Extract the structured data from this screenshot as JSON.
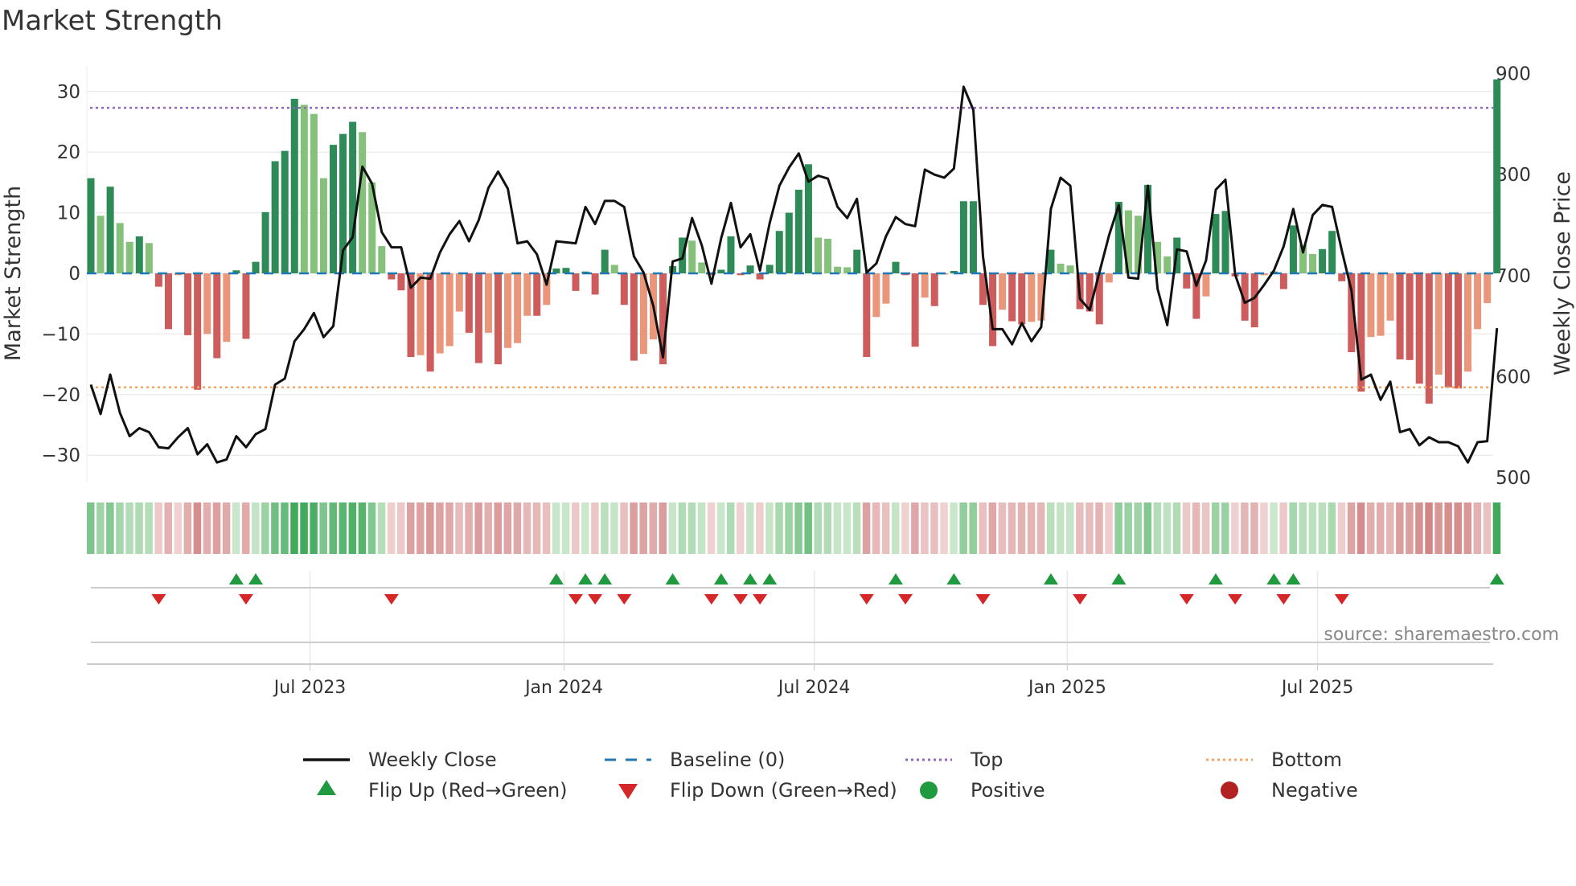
{
  "chart_data": {
    "type": "bar",
    "title": "Market Strength",
    "ylabel": "Market Strength",
    "y2label": "Weekly Close Price",
    "ylim": [
      -35,
      33.5
    ],
    "y2lim": [
      480,
      905
    ],
    "yticks": [
      30,
      20,
      10,
      0,
      -10,
      -20,
      -30
    ],
    "y2ticks": [
      900,
      800,
      700,
      600,
      500
    ],
    "xticks": [
      {
        "label": "Jul 2023",
        "week": 22.6
      },
      {
        "label": "Jan 2024",
        "week": 48.8
      },
      {
        "label": "Jul 2024",
        "week": 74.6
      },
      {
        "label": "Jan 2025",
        "week": 100.7
      },
      {
        "label": "Jul 2025",
        "week": 126.5
      }
    ],
    "top_level": 27.3,
    "bottom_level": -18.8,
    "strength": [
      15.7,
      9.5,
      14.3,
      8.3,
      5.2,
      6.1,
      5,
      -2.2,
      -9.2,
      -0.3,
      -10.2,
      -19.2,
      -10,
      -14,
      -11.3,
      0.5,
      -10.8,
      1.9,
      10.1,
      18.5,
      20.2,
      28.8,
      27.8,
      26.3,
      15.7,
      21.2,
      23,
      25,
      23.3,
      15,
      4.5,
      -1,
      -2.8,
      -13.8,
      -13.5,
      -16.2,
      -13.2,
      -12,
      -6.3,
      -9.8,
      -14.8,
      -9.8,
      -15,
      -12.3,
      -11.5,
      -7,
      -7,
      -5.2,
      0.8,
      0.9,
      -2.9,
      0.3,
      -3.5,
      3.9,
      1.4,
      -5.2,
      -14.4,
      -13.3,
      -10.9,
      -15,
      1.2,
      5.9,
      5.4,
      1.8,
      -0.3,
      0.6,
      6.1,
      -0.3,
      1.3,
      -1,
      1.4,
      7,
      10,
      13.8,
      18,
      5.9,
      5.7,
      1.1,
      1,
      3.9,
      -13.8,
      -7.2,
      -5,
      1.9,
      -0.3,
      -12.1,
      -4,
      -5.4,
      -0.2,
      0.4,
      11.9,
      11.9,
      -5.2,
      -12,
      -6,
      -7.9,
      -8.4,
      -8,
      -7.8,
      3.9,
      1.6,
      1.3,
      -5.9,
      -6.3,
      -8.4,
      -1.5,
      11.8,
      10.4,
      9.5,
      14.6,
      5.2,
      2.8,
      5.9,
      -2.5,
      -7.5,
      -3.8,
      9.8,
      10.3,
      -0.5,
      -7.8,
      -8.9,
      -0.3,
      0.3,
      -2.6,
      7.9,
      4.7,
      3.2,
      4,
      7,
      -1.3,
      -13,
      -19.5,
      -10.5,
      -10.3,
      -7.8,
      -14.2,
      -14.3,
      -18.2,
      -21.5,
      -16.7,
      -18.8,
      -19,
      -16.2,
      -9.2,
      -4.9,
      32
    ],
    "weekly_close": [
      592,
      563,
      602,
      564,
      541,
      549,
      545,
      530,
      529,
      540,
      549,
      523,
      533,
      515,
      518,
      541,
      530,
      543,
      548,
      592,
      598,
      635,
      647,
      663,
      639,
      650,
      725,
      738,
      808,
      791,
      743,
      728,
      728,
      688,
      698,
      697,
      723,
      741,
      754,
      734,
      755,
      787,
      803,
      786,
      732,
      734,
      721,
      691,
      734,
      733,
      732,
      768,
      751,
      774,
      774,
      768,
      719,
      703,
      670,
      619,
      714,
      717,
      757,
      730,
      692,
      737,
      772,
      728,
      741,
      705,
      752,
      789,
      807,
      821,
      793,
      799,
      796,
      768,
      757,
      776,
      703,
      712,
      739,
      758,
      751,
      749,
      805,
      800,
      797,
      806,
      887,
      864,
      719,
      647,
      647,
      632,
      653,
      635,
      649,
      766,
      797,
      789,
      677,
      666,
      703,
      740,
      770,
      698,
      697,
      789,
      687,
      651,
      726,
      724,
      690,
      715,
      785,
      795,
      701,
      673,
      678,
      691,
      705,
      729,
      766,
      723,
      760,
      770,
      768,
      725,
      685,
      597,
      602,
      577,
      595,
      545,
      548,
      532,
      540,
      535,
      535,
      531,
      515,
      535,
      536,
      648
    ],
    "colors": {
      "pos_strong": "#2e8b57",
      "pos_weak": "#86c17c",
      "neg_strong": "#cd5c5c",
      "neg_weak": "#e9967a",
      "flip_up": "#1f9a3f",
      "flip_down": "#d62728",
      "top": "#9467bd",
      "bottom": "#f4a460",
      "baseline": "#1f77b4",
      "positive": "#1f9a3f",
      "negative": "#b22222"
    },
    "legend": [
      {
        "label": "Weekly Close",
        "kind": "line"
      },
      {
        "label": "Baseline (0)",
        "kind": "dash"
      },
      {
        "label": "Top",
        "kind": "dotpurple"
      },
      {
        "label": "Bottom",
        "kind": "dotorange"
      },
      {
        "label": "Flip Up (Red→Green)",
        "kind": "up"
      },
      {
        "label": "Flip Down (Green→Red)",
        "kind": "down"
      },
      {
        "label": "Positive",
        "kind": "pos"
      },
      {
        "label": "Negative",
        "kind": "neg"
      }
    ],
    "legend_placement": "bottom",
    "source": "source: sharemaestro.com"
  }
}
